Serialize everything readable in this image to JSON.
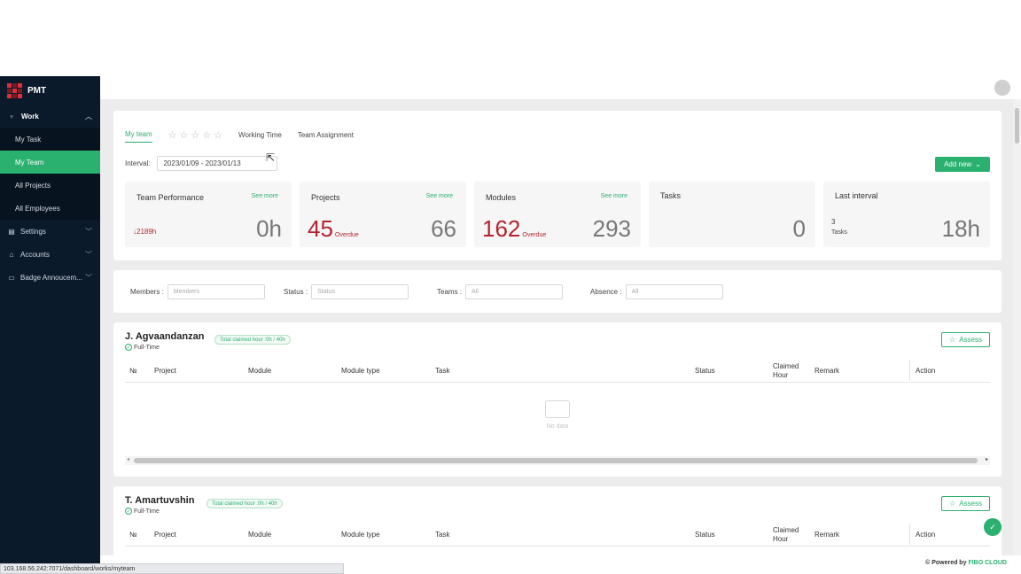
{
  "app": {
    "name": "PMT"
  },
  "sidebar": {
    "work_label": "Work",
    "work_items": [
      {
        "label": "My Task",
        "active": false
      },
      {
        "label": "My Team",
        "active": true
      },
      {
        "label": "All Projects",
        "active": false
      },
      {
        "label": "All Employees",
        "active": false
      }
    ],
    "sections": [
      {
        "label": "Settings",
        "icon": "settings-icon"
      },
      {
        "label": "Accounts",
        "icon": "accounts-icon"
      },
      {
        "label": "Badge Annoucem...",
        "icon": "badge-icon"
      }
    ]
  },
  "tabs": {
    "my_team": "My team",
    "working_time": "Working Time",
    "team_assignment": "Team Assignment"
  },
  "interval": {
    "label": "Interval:",
    "value": "2023/01/09 - 2023/01/13"
  },
  "add_new": "Add new",
  "stats": {
    "team_performance": {
      "title": "Team Performance",
      "see_more": "See more",
      "delta": "2189h",
      "value": "0h"
    },
    "projects": {
      "title": "Projects",
      "see_more": "See more",
      "overdue": "45",
      "overdue_label": "Overdue",
      "value": "66"
    },
    "modules": {
      "title": "Modules",
      "see_more": "See more",
      "overdue": "162",
      "overdue_label": "Overdue",
      "value": "293"
    },
    "tasks": {
      "title": "Tasks",
      "value": "0"
    },
    "last_interval": {
      "title": "Last interval",
      "tasks_count": "3",
      "tasks_label": "Tasks",
      "value": "18h"
    }
  },
  "filters": {
    "members": {
      "label": "Members :",
      "placeholder": "Members"
    },
    "status": {
      "label": "Status :",
      "placeholder": "Status"
    },
    "teams": {
      "label": "Teams :",
      "placeholder": "All"
    },
    "absence": {
      "label": "Absence :",
      "placeholder": "All"
    }
  },
  "table_headers": {
    "no": "№",
    "project": "Project",
    "module": "Module",
    "module_type": "Module type",
    "task": "Task",
    "status": "Status",
    "claimed": "Claimed",
    "hour": "Hour",
    "remark": "Remark",
    "action": "Action"
  },
  "members": [
    {
      "name": "J. Agvaandanzan",
      "type": "Full-Time",
      "claimed": "Total claimed hour :0h / 40h",
      "assess": "Assess",
      "no_data": "No data"
    },
    {
      "name": "T. Amartuvshin",
      "type": "Full-Time",
      "claimed": "Total claimed hour :0h / 40h",
      "assess": "Assess"
    }
  ],
  "footer": {
    "powered": "Powered by",
    "brand": "FIBO CLOUD"
  },
  "status_url": "103.168.56.242:7071/dashboard/works/myteam",
  "colors": {
    "accent": "#2ab06f",
    "danger": "#b3242f",
    "sidebar": "#0b1a2b"
  }
}
